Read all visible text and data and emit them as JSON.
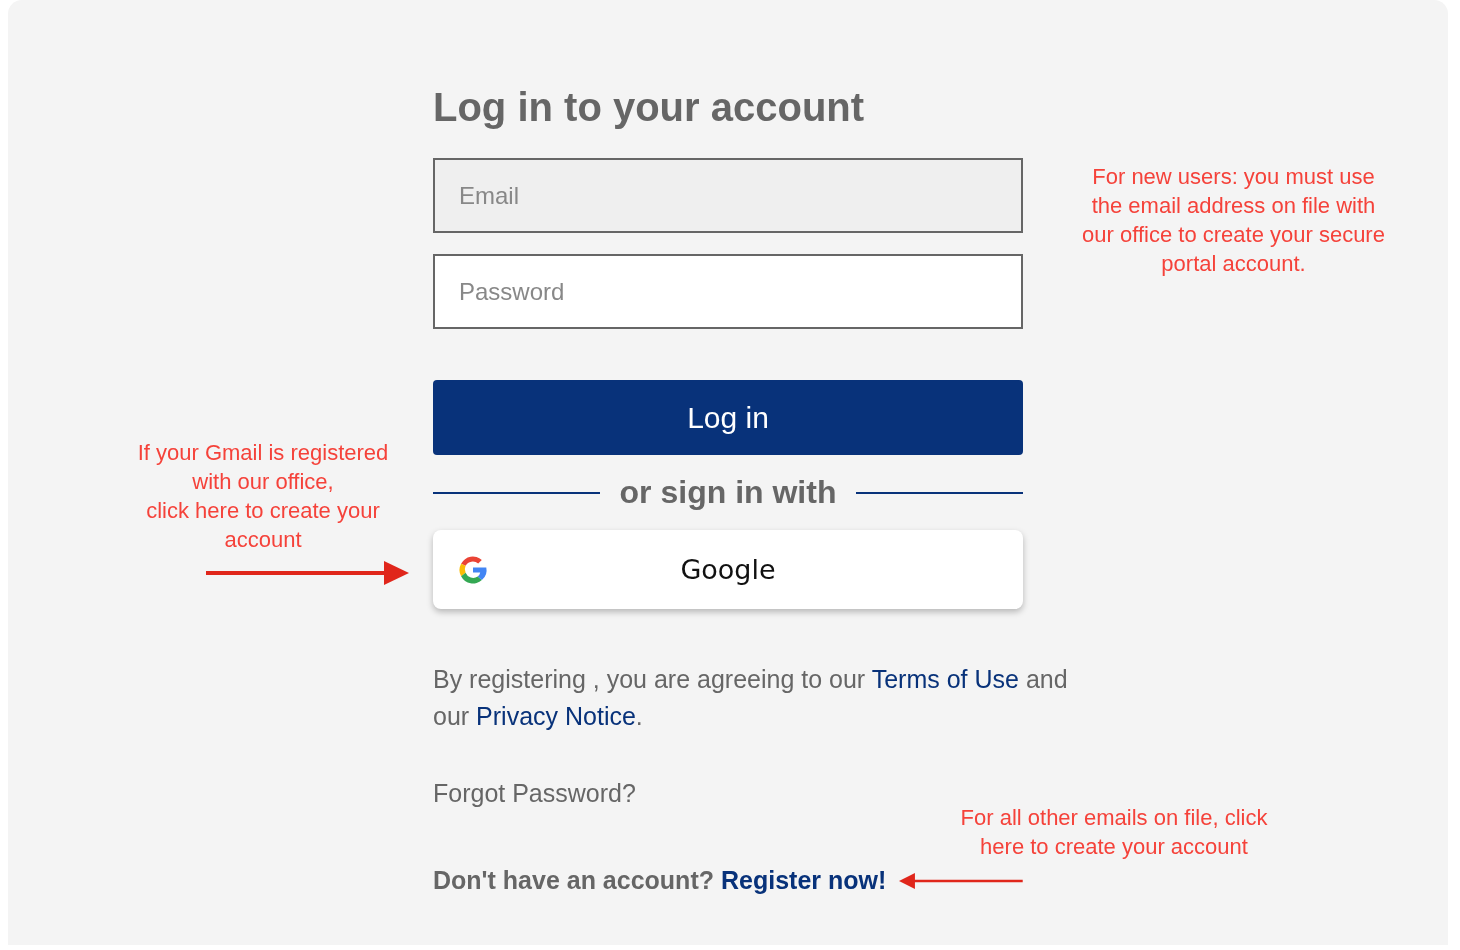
{
  "title": "Log in to your account",
  "fields": [
    {
      "placeholder": "Email",
      "highlighted": true
    },
    {
      "placeholder": "Password",
      "highlighted": false
    }
  ],
  "login_button": "Log in",
  "divider_text": "or sign in with",
  "google_button": "Google",
  "terms": [
    {
      "kind": "text",
      "text": "By registering , you are agreeing to our "
    },
    {
      "kind": "link",
      "text": "Terms of Use"
    },
    {
      "kind": "text",
      "text": " and our "
    },
    {
      "kind": "link",
      "text": "Privacy Notice"
    },
    {
      "kind": "text",
      "text": "."
    }
  ],
  "forgot_password": "Forgot Password?",
  "register_prompt": "Don't have an account?",
  "register_link": "Register now!",
  "annotations": [
    {
      "kind": "left",
      "lines": [
        "If your Gmail is registered",
        "with our office,",
        "click here to create your",
        "account"
      ]
    },
    {
      "kind": "right",
      "lines": [
        "For new users: you must use",
        "the email address on file with",
        "our office to create your secure",
        "portal account."
      ]
    },
    {
      "kind": "bottom",
      "lines": [
        "For all other emails on file, click",
        "here to create your account"
      ]
    }
  ]
}
